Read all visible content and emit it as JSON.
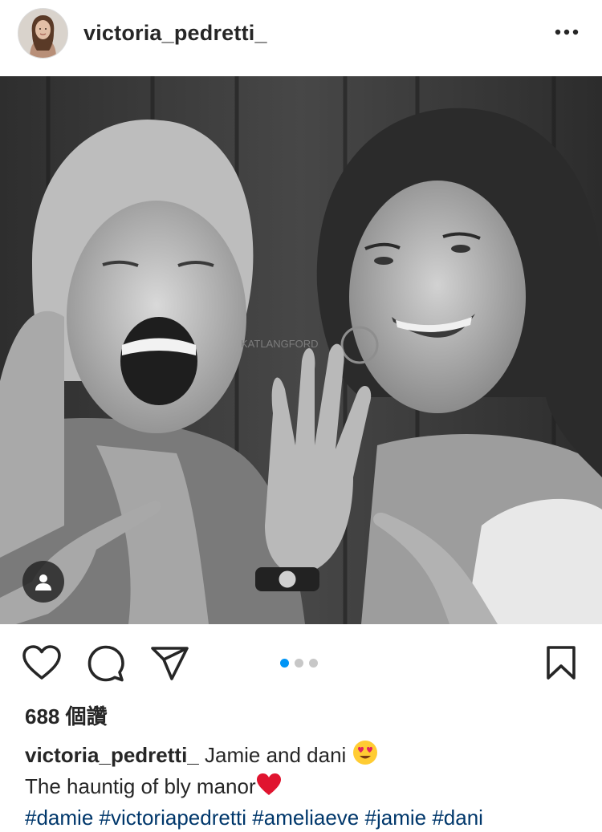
{
  "post": {
    "username": "victoria_pedretti_",
    "likes": "688 個讚",
    "caption": {
      "username": "victoria_pedretti_",
      "line1": "Jamie and dani",
      "line2": "The hauntig of bly manor",
      "hashtags": [
        "#damie",
        "#victoriapedretti",
        "#ameliaeve",
        "#jamie",
        "#dani"
      ]
    },
    "photo_watermark": "KATLANGFORD",
    "carousel": {
      "count": 3,
      "active_index": 0
    }
  },
  "icons": {
    "more": "more-options-icon",
    "like": "heart-icon",
    "comment": "comment-icon",
    "share": "send-icon",
    "save": "bookmark-icon",
    "tag": "person-tag-icon"
  },
  "colors": {
    "link": "#00376b",
    "carousel_active": "#0095f6",
    "text": "#262626"
  }
}
